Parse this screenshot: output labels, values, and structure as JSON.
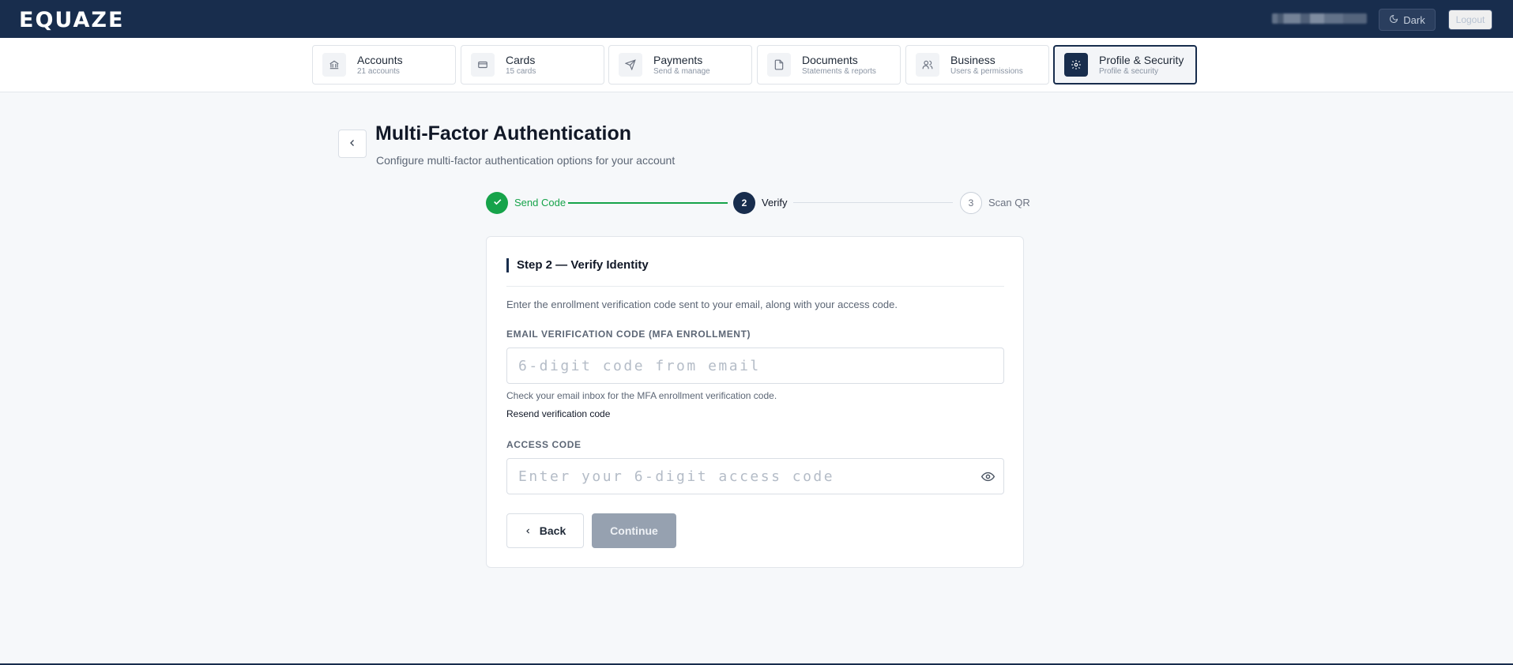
{
  "app": {
    "logo": "EQUAZE"
  },
  "header": {
    "theme_button": "Dark",
    "logout_button": "Logout"
  },
  "nav": {
    "tabs": [
      {
        "label": "Accounts",
        "sub": "21 accounts",
        "icon": "bank-icon"
      },
      {
        "label": "Cards",
        "sub": "15 cards",
        "icon": "credit-card-icon"
      },
      {
        "label": "Payments",
        "sub": "Send & manage",
        "icon": "send-icon"
      },
      {
        "label": "Documents",
        "sub": "Statements & reports",
        "icon": "document-icon"
      },
      {
        "label": "Business",
        "sub": "Users & permissions",
        "icon": "users-icon"
      },
      {
        "label": "Profile & Security",
        "sub": "Profile & security",
        "icon": "gear-icon",
        "active": true
      }
    ]
  },
  "page": {
    "title": "Multi-Factor Authentication",
    "subtitle": "Configure multi-factor authentication options for your account"
  },
  "stepper": {
    "steps": [
      {
        "number": "1",
        "label": "Send Code",
        "status": "completed"
      },
      {
        "number": "2",
        "label": "Verify",
        "status": "active"
      },
      {
        "number": "3",
        "label": "Scan QR",
        "status": "pending"
      }
    ]
  },
  "form": {
    "heading": "Step 2 — Verify Identity",
    "description": "Enter the enrollment verification code sent to your email, along with your access code.",
    "email_code": {
      "label": "EMAIL VERIFICATION CODE (MFA ENROLLMENT)",
      "placeholder": "6-digit code from email",
      "value": "",
      "hint": "Check your email inbox for the MFA enrollment verification code.",
      "resend_link": "Resend verification code"
    },
    "access_code": {
      "label": "ACCESS CODE",
      "placeholder": "Enter your 6-digit access code",
      "value": ""
    },
    "back_button": "Back",
    "continue_button": "Continue"
  },
  "colors": {
    "brand": "#182d4d",
    "success": "#16a34a",
    "disabled_button": "#96a1b0",
    "background": "#f6f8fa"
  }
}
